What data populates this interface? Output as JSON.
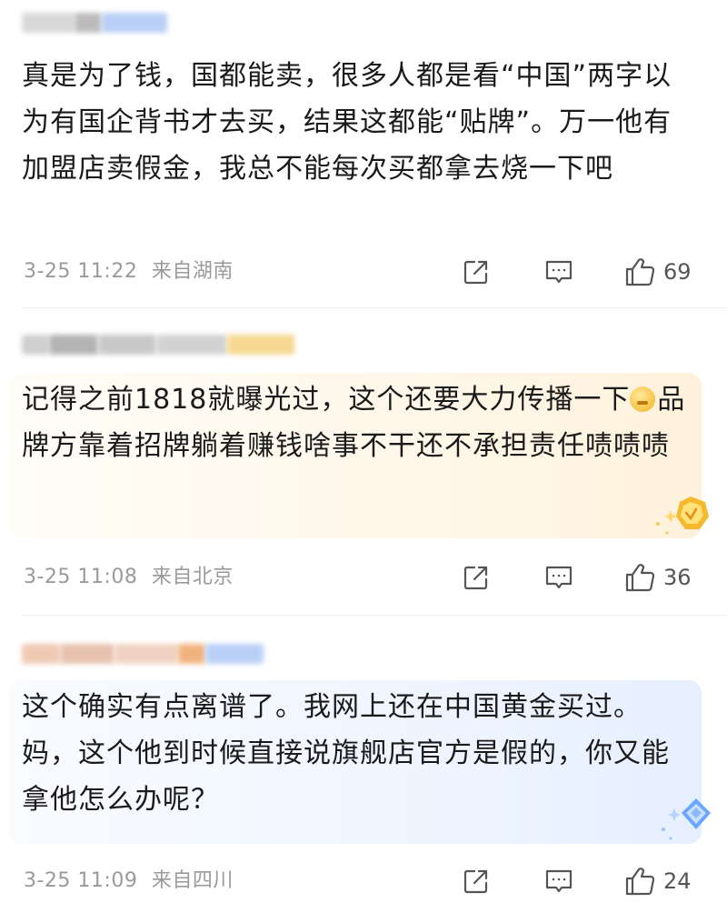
{
  "comments": [
    {
      "text": "真是为了钱，国都能卖，很多人都是看“中国”两字以为有国企背书才去买，结果这都能“贴牌”。万一他有加盟店卖假金，我总不能每次买都拿去烧一下吧",
      "time": "3-25 11:22",
      "location": "来自湖南",
      "likes": "69"
    },
    {
      "text_part1": "记得之前1818就曝光过，这个还要大力传播一下",
      "text_part2": "品牌方靠着招牌躺着赚钱啥事不干还不承担责任啧啧啧",
      "time": "3-25 11:08",
      "location": "来自北京",
      "likes": "36"
    },
    {
      "text": "这个确实有点离谱了。我网上还在中国黄金买过。妈，这个他到时候直接说旗舰店官方是假的，你又能拿他怎么办呢？",
      "time": "3-25 11:09",
      "location": "来自四川",
      "likes": "24"
    }
  ],
  "icons": {
    "share": "share-icon",
    "comment": "comment-icon",
    "like": "thumbs-up-icon",
    "emoji": "sweat-face-emoji",
    "badge_gold": "gold-fan-badge-icon",
    "badge_blue": "blue-fan-badge-icon"
  },
  "colors": {
    "meta_text": "#9a9a9a",
    "warm_bubble": "#fff6e6",
    "cool_bubble": "#edf4ff"
  }
}
